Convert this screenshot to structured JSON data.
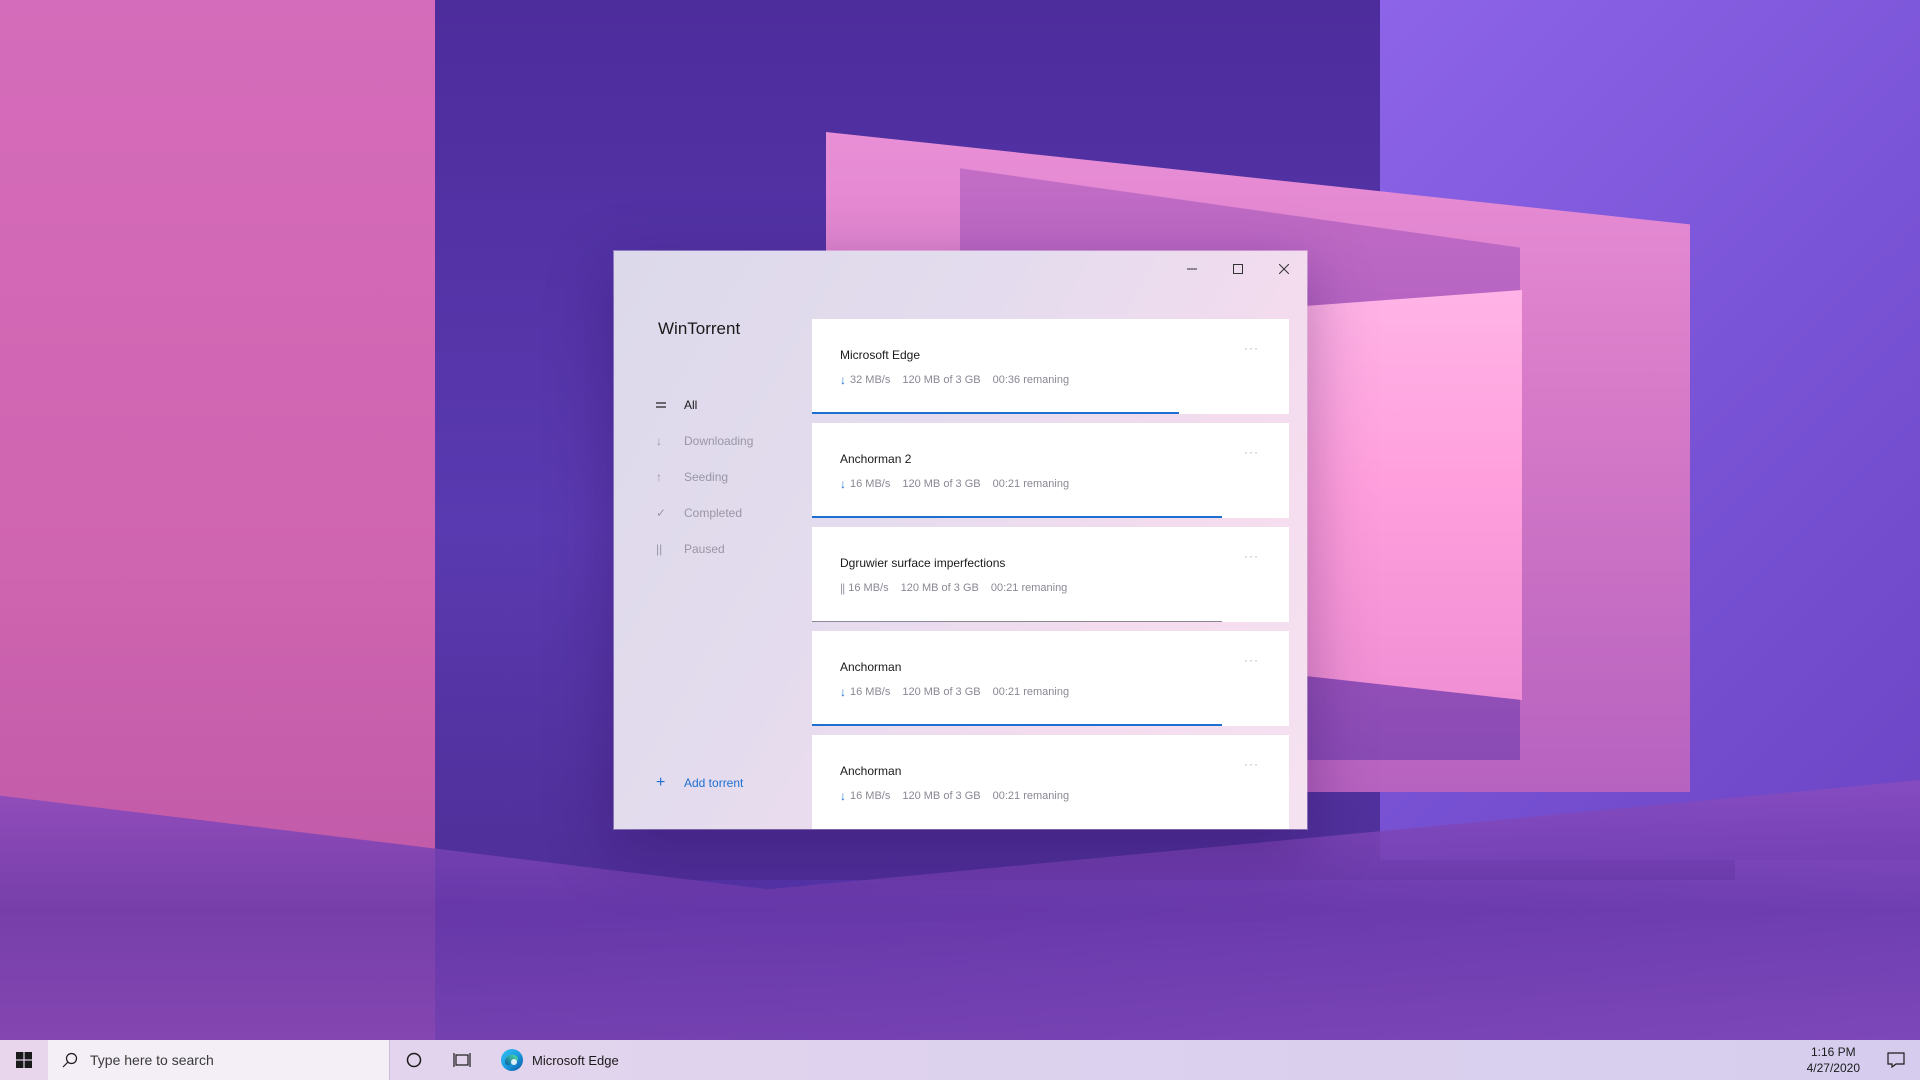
{
  "app": {
    "title": "WinTorrent",
    "window_controls": {
      "minimize_icon": "minimize-icon",
      "maximize_icon": "maximize-icon",
      "close_icon": "close-icon"
    }
  },
  "nav": {
    "items": [
      {
        "label": "All",
        "icon": "list-icon",
        "active": true
      },
      {
        "label": "Downloading",
        "icon": "arrow-down-icon",
        "active": false
      },
      {
        "label": "Seeding",
        "icon": "arrow-up-icon",
        "active": false
      },
      {
        "label": "Completed",
        "icon": "check-icon",
        "active": false
      },
      {
        "label": "Paused",
        "icon": "pause-icon",
        "active": false
      }
    ],
    "add_torrent_label": "Add torrent"
  },
  "torrents": [
    {
      "name": "Microsoft Edge",
      "status": "downloading",
      "speed": "32 MB/s",
      "size": "120 MB of 3 GB",
      "remaining": "00:36 remaning",
      "progress": 0.77
    },
    {
      "name": "Anchorman 2",
      "status": "downloading",
      "speed": "16 MB/s",
      "size": "120 MB of 3 GB",
      "remaining": "00:21 remaning",
      "progress": 0.86
    },
    {
      "name": "Dgruwier surface imperfections",
      "status": "paused",
      "speed": "16 MB/s",
      "size": "120 MB of 3 GB",
      "remaining": "00:21 remaning",
      "progress": 0.86
    },
    {
      "name": "Anchorman",
      "status": "downloading",
      "speed": "16 MB/s",
      "size": "120 MB of 3 GB",
      "remaining": "00:21 remaning",
      "progress": 0.86
    },
    {
      "name": "Anchorman",
      "status": "downloading",
      "speed": "16 MB/s",
      "size": "120 MB of 3 GB",
      "remaining": "00:21 remaning",
      "progress": 0.0
    }
  ],
  "taskbar": {
    "search_placeholder": "Type here to search",
    "pinned_app_label": "Microsoft Edge",
    "time": "1:16 PM",
    "date": "4/27/2020"
  },
  "colors": {
    "accent": "#1e6fd0",
    "window_bg": "#e4dcee"
  }
}
